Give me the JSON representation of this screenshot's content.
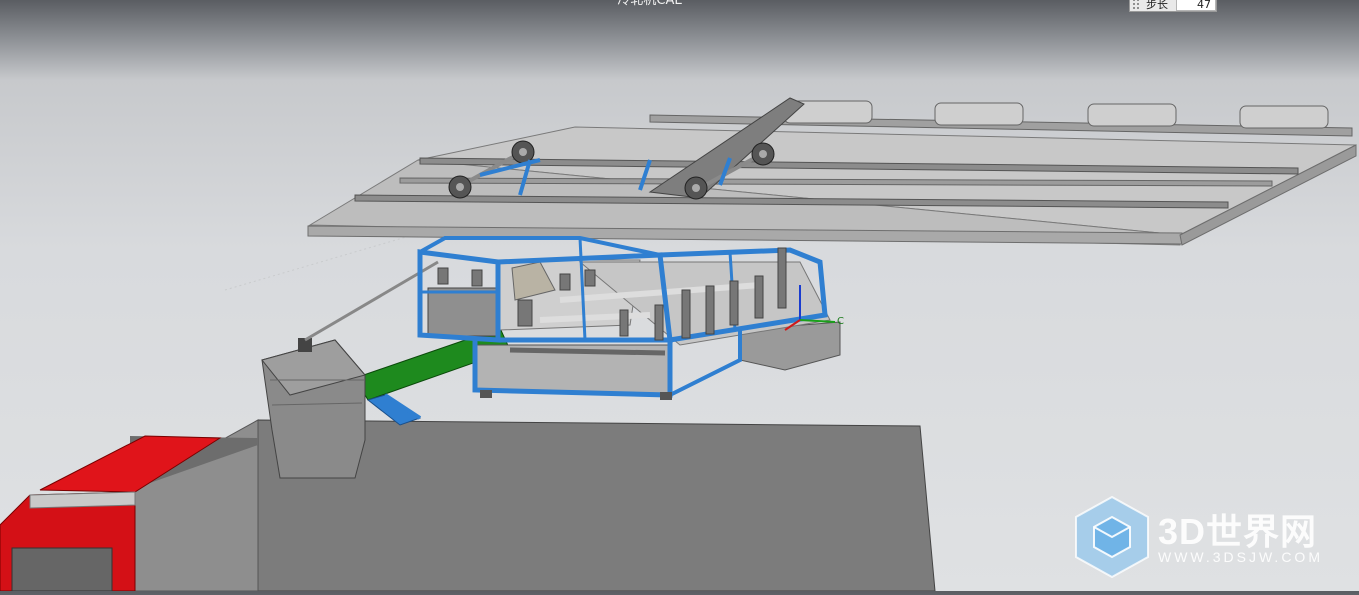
{
  "app": {
    "title": "冷轧机CAE",
    "step_label": "步长",
    "step_value": "47"
  },
  "axis": {
    "triad_label": "C"
  },
  "watermark": {
    "brand": "3D世界网",
    "url": "WWW.3DSJW.COM"
  },
  "colors": {
    "frame_blue": "#2f7fd1",
    "truck_red": "#e0141a",
    "conveyor_green": "#1e8a1e",
    "platform_gray": "#b5b5b5",
    "background": "#dcdee0"
  }
}
